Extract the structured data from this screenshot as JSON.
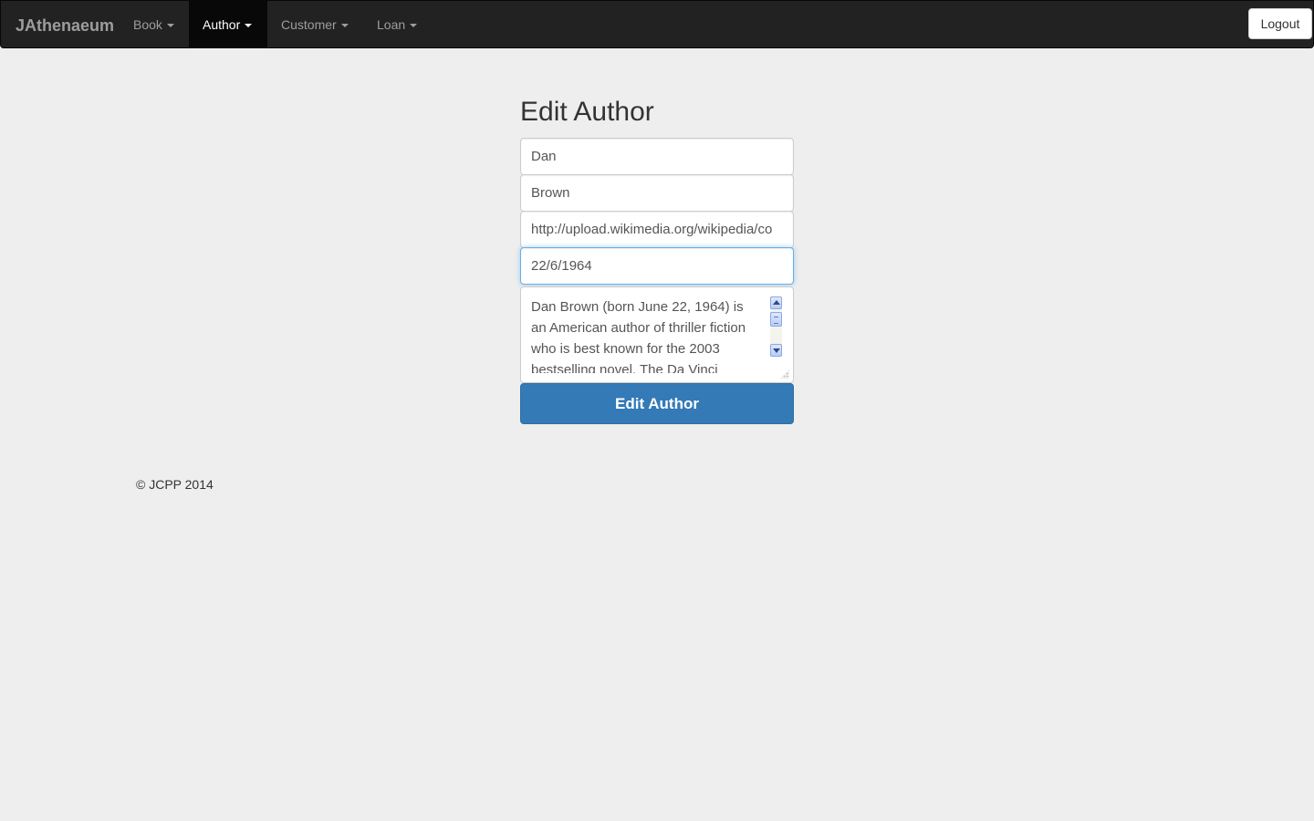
{
  "navbar": {
    "brand": "JAthenaeum",
    "items": [
      {
        "label": "Book",
        "active": false
      },
      {
        "label": "Author",
        "active": true
      },
      {
        "label": "Customer",
        "active": false
      },
      {
        "label": "Loan",
        "active": false
      }
    ],
    "logout_label": "Logout"
  },
  "form": {
    "title": "Edit Author",
    "first_name": "Dan",
    "last_name": "Brown",
    "image_url": "http://upload.wikimedia.org/wikipedia/co",
    "birth_date": "22/6/1964",
    "biography": "Dan Brown (born June 22, 1964) is an American author of thriller fiction who is best known for the 2003 bestselling novel, The Da Vinci",
    "submit_label": "Edit Author"
  },
  "footer": {
    "text": "© JCPP 2014"
  }
}
